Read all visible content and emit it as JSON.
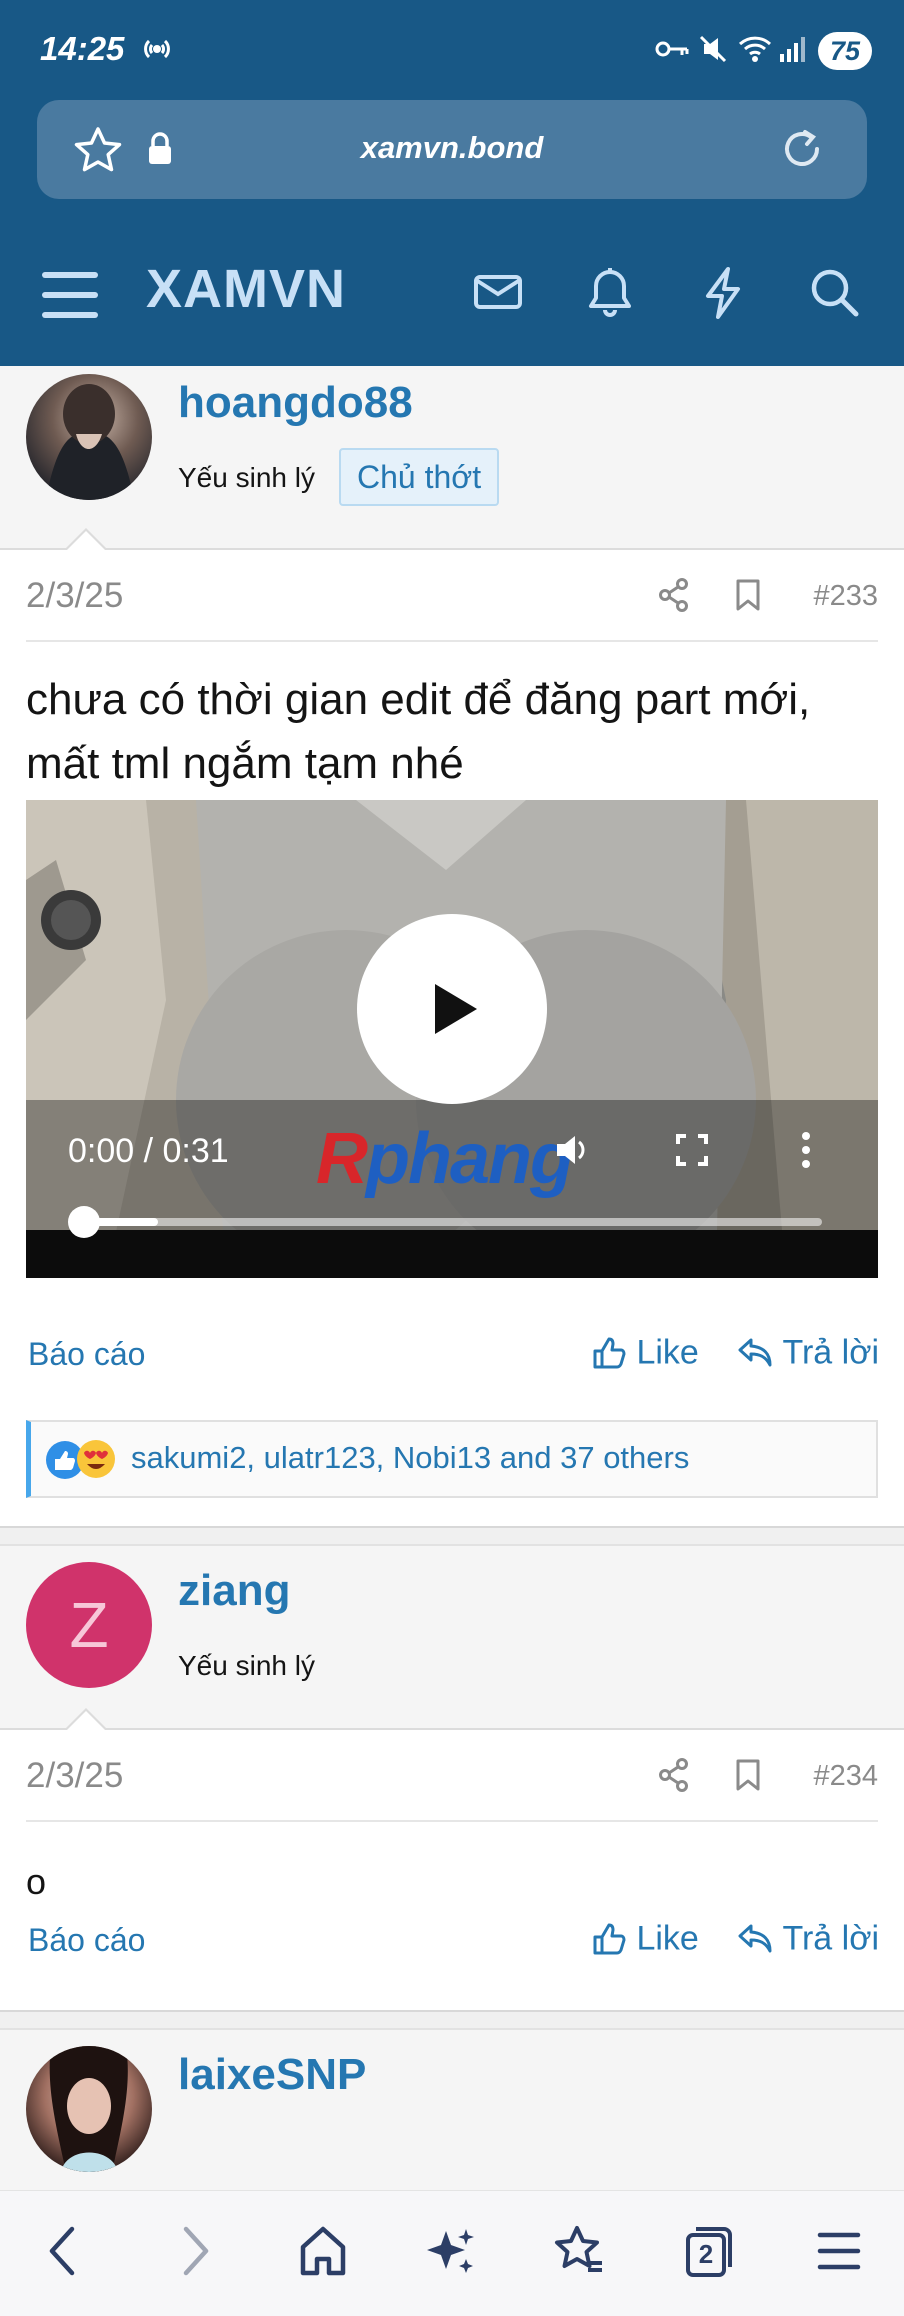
{
  "status": {
    "time": "14:25",
    "battery": "75"
  },
  "browser": {
    "url": "xamvn.bond",
    "tabs_count": "2"
  },
  "site": {
    "logo": "XAMVN"
  },
  "posts": [
    {
      "username": "hoangdo88",
      "user_title": "Yếu sinh lý",
      "badge": "Chủ thớt",
      "date": "2/3/25",
      "number": "#233",
      "text": "chưa có thời gian edit để đăng part mới, mất tml ngắm tạm nhé",
      "video": {
        "time": "0:00 / 0:31",
        "watermark_red": "R",
        "watermark_blue": "phang",
        "progress": 0.0
      },
      "report_label": "Báo cáo",
      "like_label": "Like",
      "reply_label": "Trả lời",
      "reactions": "sakumi2, ulatr123, Nobi13 and 37 others"
    },
    {
      "username": "ziang",
      "avatar_letter": "Z",
      "user_title": "Yếu sinh lý",
      "date": "2/3/25",
      "number": "#234",
      "text": "o",
      "report_label": "Báo cáo",
      "like_label": "Like",
      "reply_label": "Trả lời"
    },
    {
      "username": "laixeSNP"
    }
  ],
  "colors": {
    "header": "#185886",
    "link": "#2577b1",
    "avatar_z": "#d0336b"
  }
}
